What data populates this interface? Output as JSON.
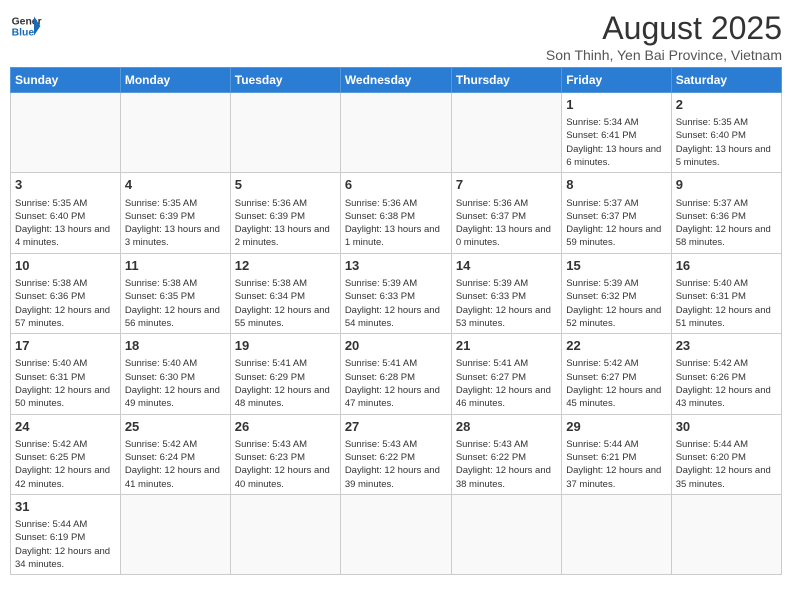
{
  "header": {
    "logo_line1": "General",
    "logo_line2": "Blue",
    "title": "August 2025",
    "subtitle": "Son Thinh, Yen Bai Province, Vietnam"
  },
  "days_of_week": [
    "Sunday",
    "Monday",
    "Tuesday",
    "Wednesday",
    "Thursday",
    "Friday",
    "Saturday"
  ],
  "weeks": [
    [
      {
        "day": "",
        "info": ""
      },
      {
        "day": "",
        "info": ""
      },
      {
        "day": "",
        "info": ""
      },
      {
        "day": "",
        "info": ""
      },
      {
        "day": "",
        "info": ""
      },
      {
        "day": "1",
        "info": "Sunrise: 5:34 AM\nSunset: 6:41 PM\nDaylight: 13 hours and 6 minutes."
      },
      {
        "day": "2",
        "info": "Sunrise: 5:35 AM\nSunset: 6:40 PM\nDaylight: 13 hours and 5 minutes."
      }
    ],
    [
      {
        "day": "3",
        "info": "Sunrise: 5:35 AM\nSunset: 6:40 PM\nDaylight: 13 hours and 4 minutes."
      },
      {
        "day": "4",
        "info": "Sunrise: 5:35 AM\nSunset: 6:39 PM\nDaylight: 13 hours and 3 minutes."
      },
      {
        "day": "5",
        "info": "Sunrise: 5:36 AM\nSunset: 6:39 PM\nDaylight: 13 hours and 2 minutes."
      },
      {
        "day": "6",
        "info": "Sunrise: 5:36 AM\nSunset: 6:38 PM\nDaylight: 13 hours and 1 minute."
      },
      {
        "day": "7",
        "info": "Sunrise: 5:36 AM\nSunset: 6:37 PM\nDaylight: 13 hours and 0 minutes."
      },
      {
        "day": "8",
        "info": "Sunrise: 5:37 AM\nSunset: 6:37 PM\nDaylight: 12 hours and 59 minutes."
      },
      {
        "day": "9",
        "info": "Sunrise: 5:37 AM\nSunset: 6:36 PM\nDaylight: 12 hours and 58 minutes."
      }
    ],
    [
      {
        "day": "10",
        "info": "Sunrise: 5:38 AM\nSunset: 6:36 PM\nDaylight: 12 hours and 57 minutes."
      },
      {
        "day": "11",
        "info": "Sunrise: 5:38 AM\nSunset: 6:35 PM\nDaylight: 12 hours and 56 minutes."
      },
      {
        "day": "12",
        "info": "Sunrise: 5:38 AM\nSunset: 6:34 PM\nDaylight: 12 hours and 55 minutes."
      },
      {
        "day": "13",
        "info": "Sunrise: 5:39 AM\nSunset: 6:33 PM\nDaylight: 12 hours and 54 minutes."
      },
      {
        "day": "14",
        "info": "Sunrise: 5:39 AM\nSunset: 6:33 PM\nDaylight: 12 hours and 53 minutes."
      },
      {
        "day": "15",
        "info": "Sunrise: 5:39 AM\nSunset: 6:32 PM\nDaylight: 12 hours and 52 minutes."
      },
      {
        "day": "16",
        "info": "Sunrise: 5:40 AM\nSunset: 6:31 PM\nDaylight: 12 hours and 51 minutes."
      }
    ],
    [
      {
        "day": "17",
        "info": "Sunrise: 5:40 AM\nSunset: 6:31 PM\nDaylight: 12 hours and 50 minutes."
      },
      {
        "day": "18",
        "info": "Sunrise: 5:40 AM\nSunset: 6:30 PM\nDaylight: 12 hours and 49 minutes."
      },
      {
        "day": "19",
        "info": "Sunrise: 5:41 AM\nSunset: 6:29 PM\nDaylight: 12 hours and 48 minutes."
      },
      {
        "day": "20",
        "info": "Sunrise: 5:41 AM\nSunset: 6:28 PM\nDaylight: 12 hours and 47 minutes."
      },
      {
        "day": "21",
        "info": "Sunrise: 5:41 AM\nSunset: 6:27 PM\nDaylight: 12 hours and 46 minutes."
      },
      {
        "day": "22",
        "info": "Sunrise: 5:42 AM\nSunset: 6:27 PM\nDaylight: 12 hours and 45 minutes."
      },
      {
        "day": "23",
        "info": "Sunrise: 5:42 AM\nSunset: 6:26 PM\nDaylight: 12 hours and 43 minutes."
      }
    ],
    [
      {
        "day": "24",
        "info": "Sunrise: 5:42 AM\nSunset: 6:25 PM\nDaylight: 12 hours and 42 minutes."
      },
      {
        "day": "25",
        "info": "Sunrise: 5:42 AM\nSunset: 6:24 PM\nDaylight: 12 hours and 41 minutes."
      },
      {
        "day": "26",
        "info": "Sunrise: 5:43 AM\nSunset: 6:23 PM\nDaylight: 12 hours and 40 minutes."
      },
      {
        "day": "27",
        "info": "Sunrise: 5:43 AM\nSunset: 6:22 PM\nDaylight: 12 hours and 39 minutes."
      },
      {
        "day": "28",
        "info": "Sunrise: 5:43 AM\nSunset: 6:22 PM\nDaylight: 12 hours and 38 minutes."
      },
      {
        "day": "29",
        "info": "Sunrise: 5:44 AM\nSunset: 6:21 PM\nDaylight: 12 hours and 37 minutes."
      },
      {
        "day": "30",
        "info": "Sunrise: 5:44 AM\nSunset: 6:20 PM\nDaylight: 12 hours and 35 minutes."
      }
    ],
    [
      {
        "day": "31",
        "info": "Sunrise: 5:44 AM\nSunset: 6:19 PM\nDaylight: 12 hours and 34 minutes."
      },
      {
        "day": "",
        "info": ""
      },
      {
        "day": "",
        "info": ""
      },
      {
        "day": "",
        "info": ""
      },
      {
        "day": "",
        "info": ""
      },
      {
        "day": "",
        "info": ""
      },
      {
        "day": "",
        "info": ""
      }
    ]
  ]
}
